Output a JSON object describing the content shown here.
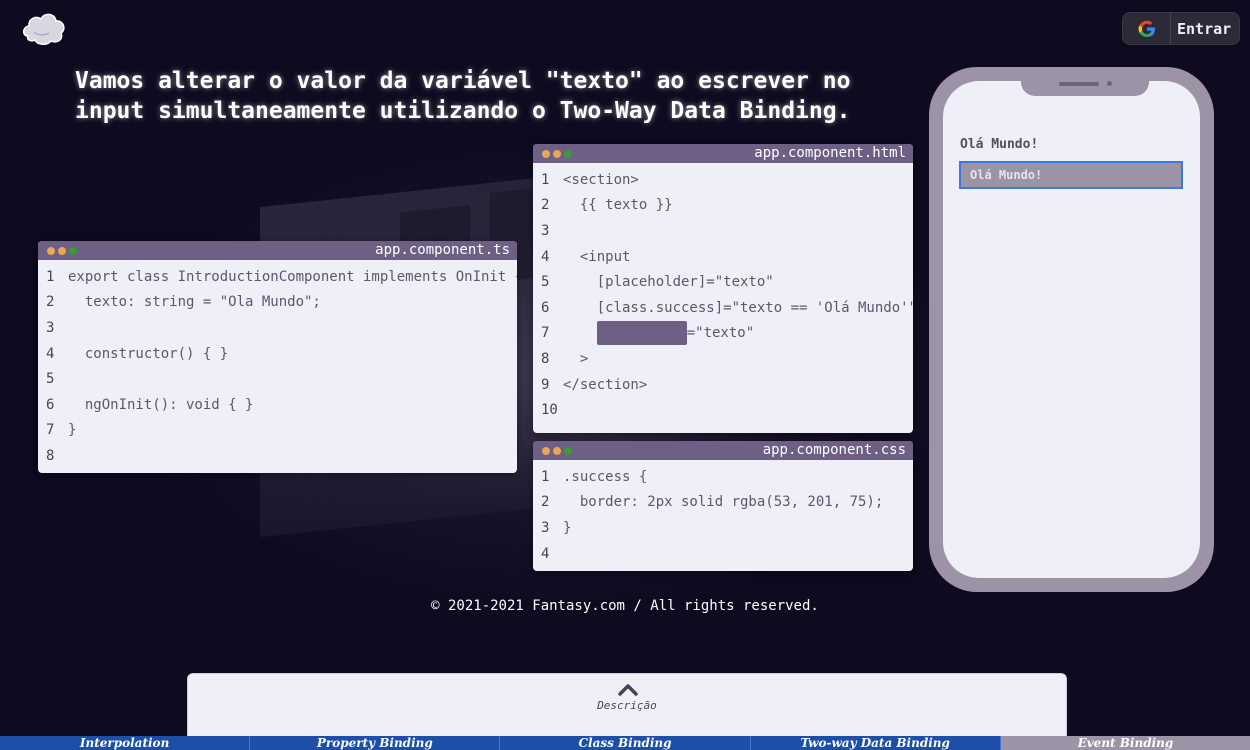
{
  "header": {
    "login_label": "Entrar",
    "login_icon": "google-icon",
    "logo_icon": "cloud-logo-icon"
  },
  "headline": "Vamos alterar o valor da variável \"texto\" ao escrever no input simultaneamente utilizando o Two-Way Data Binding.",
  "code_ts": {
    "title": "app.component.ts",
    "lines": [
      {
        "n": "1",
        "code": "export class IntroductionComponent implements OnInit {"
      },
      {
        "n": "2",
        "code": "  texto: string = \"Ola Mundo\";"
      },
      {
        "n": "3",
        "code": ""
      },
      {
        "n": "4",
        "code": "  constructor() { }"
      },
      {
        "n": "5",
        "code": ""
      },
      {
        "n": "6",
        "code": "  ngOnInit(): void { }"
      },
      {
        "n": "7",
        "code": "}"
      },
      {
        "n": "8",
        "code": ""
      }
    ]
  },
  "code_html": {
    "title": "app.component.html",
    "lines": [
      {
        "n": "1",
        "code": "<section>"
      },
      {
        "n": "2",
        "code": "  {{ texto }}"
      },
      {
        "n": "3",
        "code": ""
      },
      {
        "n": "4",
        "code": "  <input"
      },
      {
        "n": "5",
        "code": "    [placeholder]=\"texto\""
      },
      {
        "n": "6",
        "code": "    [class.success]=\"texto == 'Olá Mundo'\""
      },
      {
        "n": "7",
        "code": "=\"texto\"",
        "masked": true,
        "indent": "    "
      },
      {
        "n": "8",
        "code": "  >"
      },
      {
        "n": "9",
        "code": "</section>"
      },
      {
        "n": "10",
        "code": ""
      }
    ]
  },
  "code_css": {
    "title": "app.component.css",
    "lines": [
      {
        "n": "1",
        "code": ".success {"
      },
      {
        "n": "2",
        "code": "  border: 2px solid rgba(53, 201, 75);"
      },
      {
        "n": "3",
        "code": "}"
      },
      {
        "n": "4",
        "code": ""
      }
    ]
  },
  "phone": {
    "output_text": "Olá Mundo!",
    "input_value": "Olá Mundo!"
  },
  "footer": {
    "copyright": "© 2021-2021 Fantasy.com / All rights reserved."
  },
  "description": {
    "label": "Descrição"
  },
  "nav": {
    "tabs": [
      {
        "label": "Interpolation",
        "active": false
      },
      {
        "label": "Property Binding",
        "active": false
      },
      {
        "label": "Class Binding",
        "active": false
      },
      {
        "label": "Two-way Data Binding",
        "active": false
      },
      {
        "label": "Event Binding",
        "active": true
      }
    ]
  },
  "colors": {
    "background": "#0e0a1f",
    "code_titlebar": "#6e5f85",
    "code_bg": "#efeff7",
    "phone_frame": "#9c94a6",
    "nav_bg": "#1d4fa8",
    "success_green": "#35c94b"
  }
}
